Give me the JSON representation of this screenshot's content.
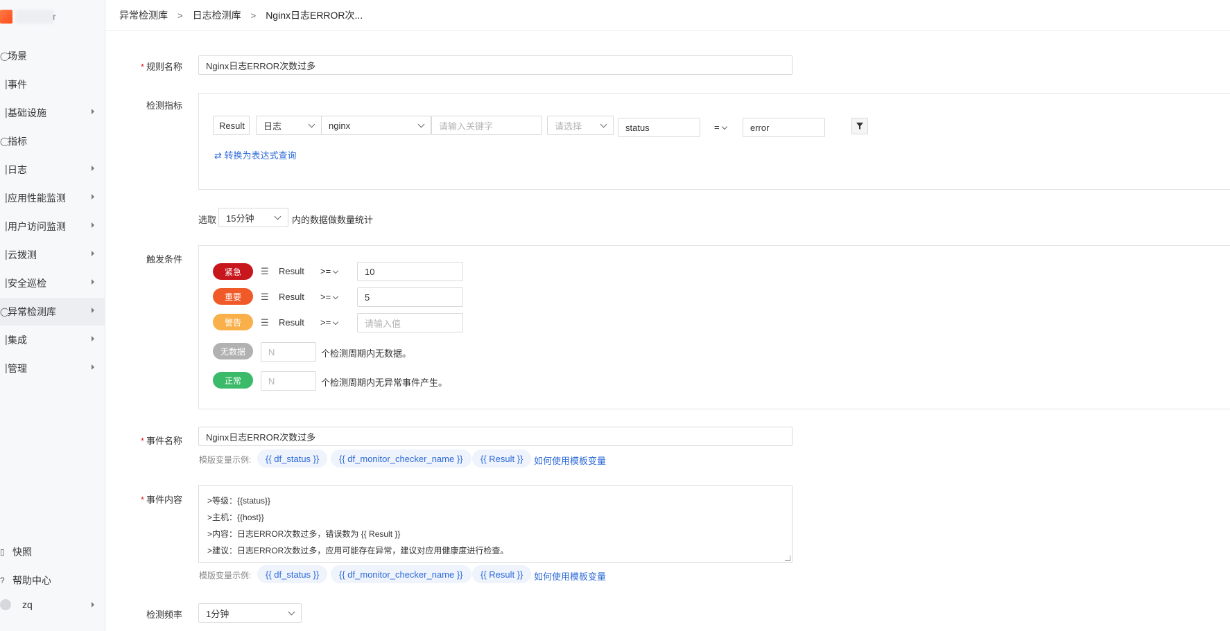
{
  "sidebar": {
    "logo_text": "r",
    "items": [
      {
        "label": "场景",
        "icon": "scene-icon",
        "arrow": false
      },
      {
        "label": "事件",
        "icon": "event-icon",
        "arrow": false
      },
      {
        "label": "基础设施",
        "icon": "infrastructure-icon",
        "arrow": true
      },
      {
        "label": "指标",
        "icon": "metric-icon",
        "arrow": false
      },
      {
        "label": "日志",
        "icon": "log-icon",
        "arrow": true
      },
      {
        "label": "应用性能监测",
        "icon": "apm-icon",
        "arrow": true
      },
      {
        "label": "用户访问监测",
        "icon": "rum-icon",
        "arrow": true
      },
      {
        "label": "云拨测",
        "icon": "dialtest-icon",
        "arrow": true
      },
      {
        "label": "安全巡检",
        "icon": "security-icon",
        "arrow": true
      },
      {
        "label": "异常检测库",
        "icon": "monitor-icon",
        "arrow": true
      },
      {
        "label": "集成",
        "icon": "integration-icon",
        "arrow": true
      },
      {
        "label": "管理",
        "icon": "management-icon",
        "arrow": true
      }
    ],
    "bottom": {
      "snapshot": "快照",
      "help": "帮助中心",
      "user": "zq"
    }
  },
  "breadcrumb": [
    "异常检测库",
    "日志检测库",
    "Nginx日志ERROR次..."
  ],
  "form": {
    "rule_name_label": "规则名称",
    "rule_name_value": "Nginx日志ERROR次数过多",
    "metric_label": "检测指标",
    "metric": {
      "result_alias": "Result",
      "source": "日志",
      "index": "nginx",
      "keyword_placeholder": "请输入关键字",
      "select_placeholder": "请选择",
      "field": "status",
      "operator": "=",
      "value": "error",
      "convert_link": "⇄ 转换为表达式查询"
    },
    "window_prefix": "选取",
    "window_value": "15分钟",
    "window_suffix": "内的数据做数量统计",
    "trigger_label": "触发条件",
    "triggers": [
      {
        "level": "紧急",
        "color": "#c8161d",
        "var": "Result",
        "op": ">=",
        "value": "10",
        "placeholder": ""
      },
      {
        "level": "重要",
        "color": "#f05a28",
        "var": "Result",
        "op": ">=",
        "value": "5",
        "placeholder": ""
      },
      {
        "level": "警告",
        "color": "#f9b04b",
        "var": "Result",
        "op": ">=",
        "value": "",
        "placeholder": "请输入值"
      }
    ],
    "nodata": {
      "level": "无数据",
      "color": "#b1b1b1",
      "placeholder": "N",
      "text": "个检测周期内无数据。"
    },
    "normal": {
      "level": "正常",
      "color": "#3bbb6a",
      "placeholder": "N",
      "text": "个检测周期内无异常事件产生。"
    },
    "event_name_label": "事件名称",
    "event_name_value": "Nginx日志ERROR次数过多",
    "template_hint": "模版变量示例:",
    "template_tags": [
      "{{ df_status }}",
      "{{ df_monitor_checker_name }}",
      "{{ Result }}"
    ],
    "template_link": "如何使用模板变量",
    "event_content_label": "事件内容",
    "event_content_lines": [
      ">等级：{{status}}",
      ">主机：{{host}}",
      ">内容：日志ERROR次数过多，错误数为 {{ Result }}",
      ">建议：日志ERROR次数过多，应用可能存在异常，建议对应用健康度进行检查。"
    ],
    "frequency_label": "检测频率",
    "frequency_value": "1分钟"
  }
}
